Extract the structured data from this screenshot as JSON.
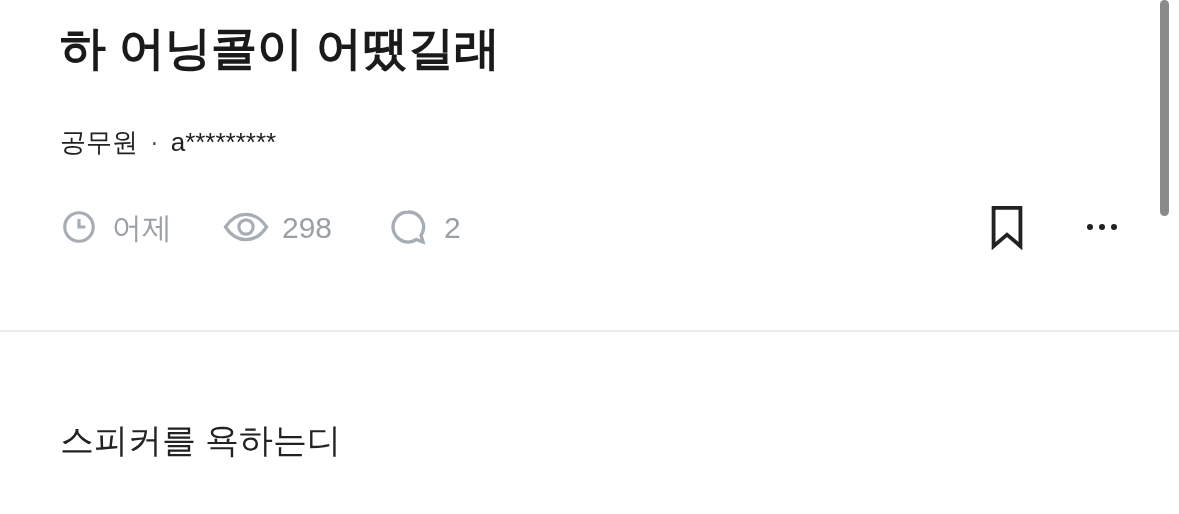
{
  "post": {
    "title": "하 어닝콜이 어땠길래",
    "author": {
      "company": "공무원",
      "separator": "·",
      "name": "a*********"
    },
    "meta": {
      "time": "어제",
      "views": "298",
      "comments": "2"
    },
    "bookmarked": false,
    "body": "스피커를 욕하는디"
  }
}
